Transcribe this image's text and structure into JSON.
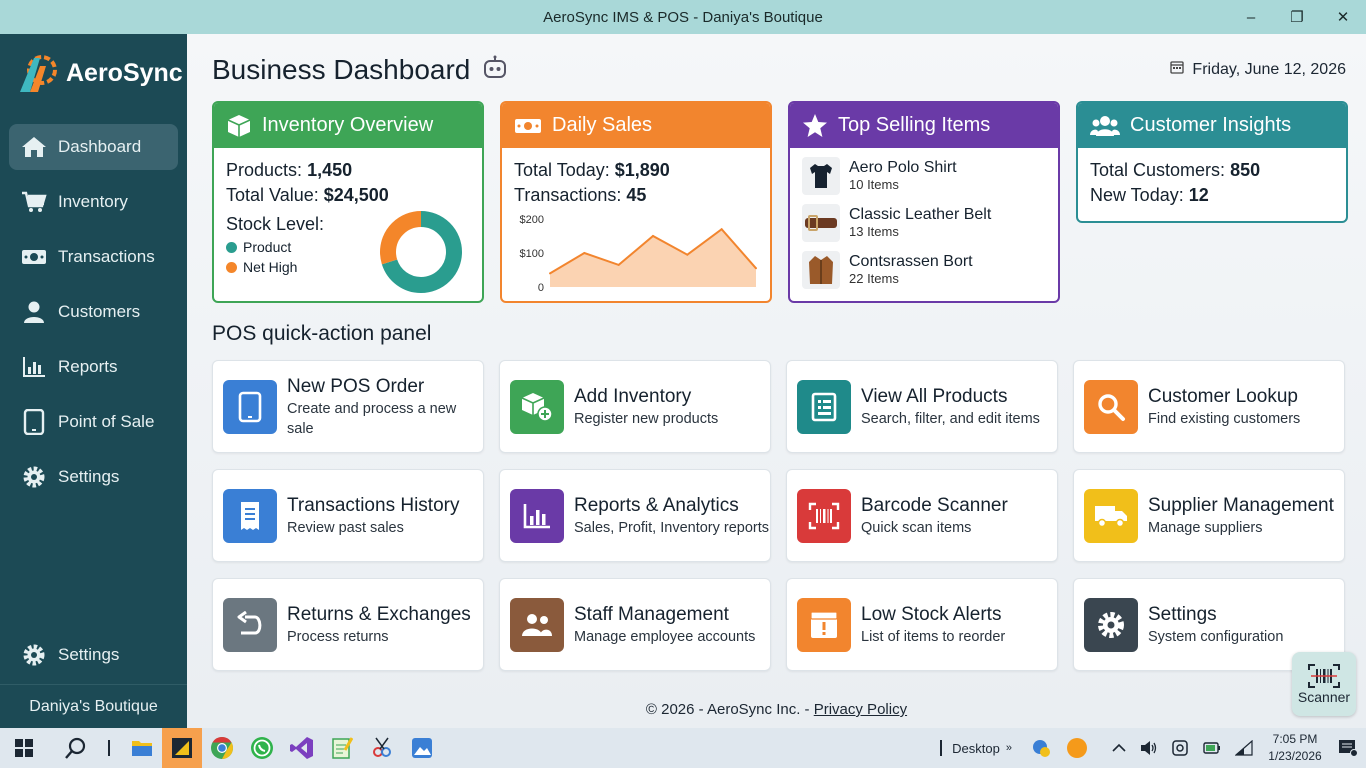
{
  "window": {
    "title": "AeroSync IMS & POS - Daniya's Boutique",
    "minimize": "–",
    "maximize": "❐",
    "close": "✕"
  },
  "sidebar": {
    "logo": "AeroSync",
    "items": [
      {
        "label": "Dashboard",
        "icon": "home-icon"
      },
      {
        "label": "Inventory",
        "icon": "cart-icon"
      },
      {
        "label": "Transactions",
        "icon": "money-icon"
      },
      {
        "label": "Customers",
        "icon": "user-icon"
      },
      {
        "label": "Reports",
        "icon": "bar-chart-icon"
      },
      {
        "label": "Point of Sale",
        "icon": "tablet-icon"
      },
      {
        "label": "Settings",
        "icon": "gear-icon"
      }
    ],
    "bottom_settings": "Settings",
    "store_name": "Daniya's Boutique"
  },
  "header": {
    "title": "Business Dashboard",
    "date": "Friday, June 12, 2026"
  },
  "cards": {
    "inventory": {
      "title": "Inventory Overview",
      "products_label": "Products:",
      "products_value": "1,450",
      "value_label": "Total Value:",
      "value_value": "$24,500",
      "stock_label": "Stock Level:",
      "legend": [
        {
          "label": "Product",
          "color": "#2a9d8f"
        },
        {
          "label": "Net High",
          "color": "#f4862a"
        }
      ]
    },
    "sales": {
      "title": "Daily Sales",
      "total_label": "Total Today:",
      "total_value": "$1,890",
      "trans_label": "Transactions:",
      "trans_value": "45",
      "chart_labels": [
        "$200",
        "$100",
        "0"
      ]
    },
    "top": {
      "title": "Top Selling Items",
      "items": [
        {
          "name": "Aero Polo Shirt",
          "count": "10 Items"
        },
        {
          "name": "Classic Leather Belt",
          "count": "13 Items"
        },
        {
          "name": "Contsrassen Bort",
          "count": "22 Items"
        }
      ]
    },
    "customers": {
      "title": "Customer Insights",
      "total_label": "Total Customers:",
      "total_value": "850",
      "new_label": "New Today:",
      "new_value": "12"
    }
  },
  "chart_data": {
    "type": "area",
    "title": "",
    "xlabel": "",
    "ylabel": "",
    "ylim": [
      0,
      200
    ],
    "y_ticks": [
      "$200",
      "$100",
      "0"
    ],
    "x": [
      0,
      1,
      2,
      3,
      4,
      5,
      6
    ],
    "values": [
      40,
      100,
      65,
      150,
      95,
      170,
      55
    ],
    "color": "#f2852e"
  },
  "donut": {
    "product_fraction": 0.7,
    "net_high_fraction": 0.3
  },
  "quick": {
    "title": "POS quick-action panel",
    "actions": [
      {
        "title": "New POS Order",
        "desc": "Create and process a new sale",
        "color": "#3a7fd5",
        "icon": "tablet-icon"
      },
      {
        "title": "Add Inventory",
        "desc": "Register new products",
        "color": "#3ea556",
        "icon": "box-add-icon"
      },
      {
        "title": "View All Products",
        "desc": "Search, filter, and edit items",
        "color": "#1f8a8a",
        "icon": "list-icon"
      },
      {
        "title": "Customer Lookup",
        "desc": "Find existing customers",
        "color": "#f2852e",
        "icon": "search-icon"
      },
      {
        "title": "Transactions History",
        "desc": "Review past sales",
        "color": "#3a7fd5",
        "icon": "receipt-icon"
      },
      {
        "title": "Reports & Analytics",
        "desc": "Sales, Profit, Inventory reports",
        "color": "#6a3aa7",
        "icon": "bar-chart-icon"
      },
      {
        "title": "Barcode Scanner",
        "desc": "Quick scan items",
        "color": "#d93a3a",
        "icon": "barcode-icon"
      },
      {
        "title": "Supplier Management",
        "desc": "Manage suppliers",
        "color": "#f1bf1a",
        "icon": "truck-icon"
      },
      {
        "title": "Returns & Exchanges",
        "desc": "Process returns",
        "color": "#6b7780",
        "icon": "return-icon"
      },
      {
        "title": "Staff Management",
        "desc": "Manage employee accounts",
        "color": "#8a5a3c",
        "icon": "staff-icon"
      },
      {
        "title": "Low Stock Alerts",
        "desc": "List of items to reorder",
        "color": "#f2852e",
        "icon": "alert-box-icon"
      },
      {
        "title": "Settings",
        "desc": "System configuration",
        "color": "#3a4650",
        "icon": "gear-icon"
      }
    ]
  },
  "footer": {
    "copyright": "© 2026 - AeroSync Inc. -",
    "privacy": "Privacy Policy"
  },
  "scanner_button": "Scanner",
  "taskbar": {
    "desktop_label": "Desktop",
    "time": "7:05 PM",
    "date": "1/23/2026"
  }
}
